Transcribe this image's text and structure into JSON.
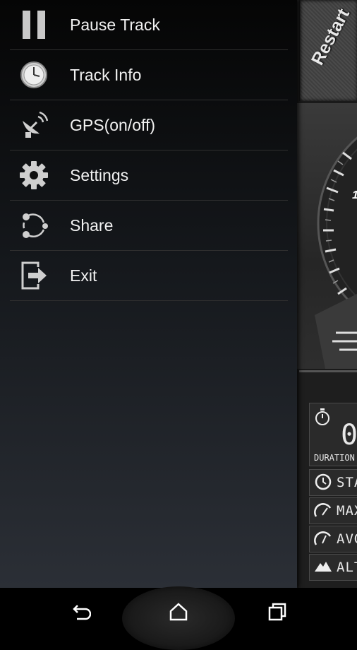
{
  "drawer": {
    "items": [
      {
        "label": "Pause Track",
        "icon": "pause-icon"
      },
      {
        "label": "Track Info",
        "icon": "clock-icon"
      },
      {
        "label": "GPS(on/off)",
        "icon": "satellite-dish-icon"
      },
      {
        "label": "Settings",
        "icon": "gear-icon"
      },
      {
        "label": "Share",
        "icon": "share-icon"
      },
      {
        "label": "Exit",
        "icon": "exit-icon"
      }
    ]
  },
  "background_app": {
    "restart_label": "Restart",
    "gauge_value": "1",
    "duration_value": "0",
    "duration_label": "DURATION",
    "stats": [
      {
        "label": "STA",
        "icon": "clock-icon"
      },
      {
        "label": "MAX",
        "icon": "speedometer-icon"
      },
      {
        "label": "AVG",
        "icon": "speedometer-icon"
      },
      {
        "label": "ALT",
        "icon": "mountain-icon"
      }
    ]
  },
  "navbar": {
    "back": "back-icon",
    "home": "home-icon",
    "recents": "recents-icon"
  }
}
